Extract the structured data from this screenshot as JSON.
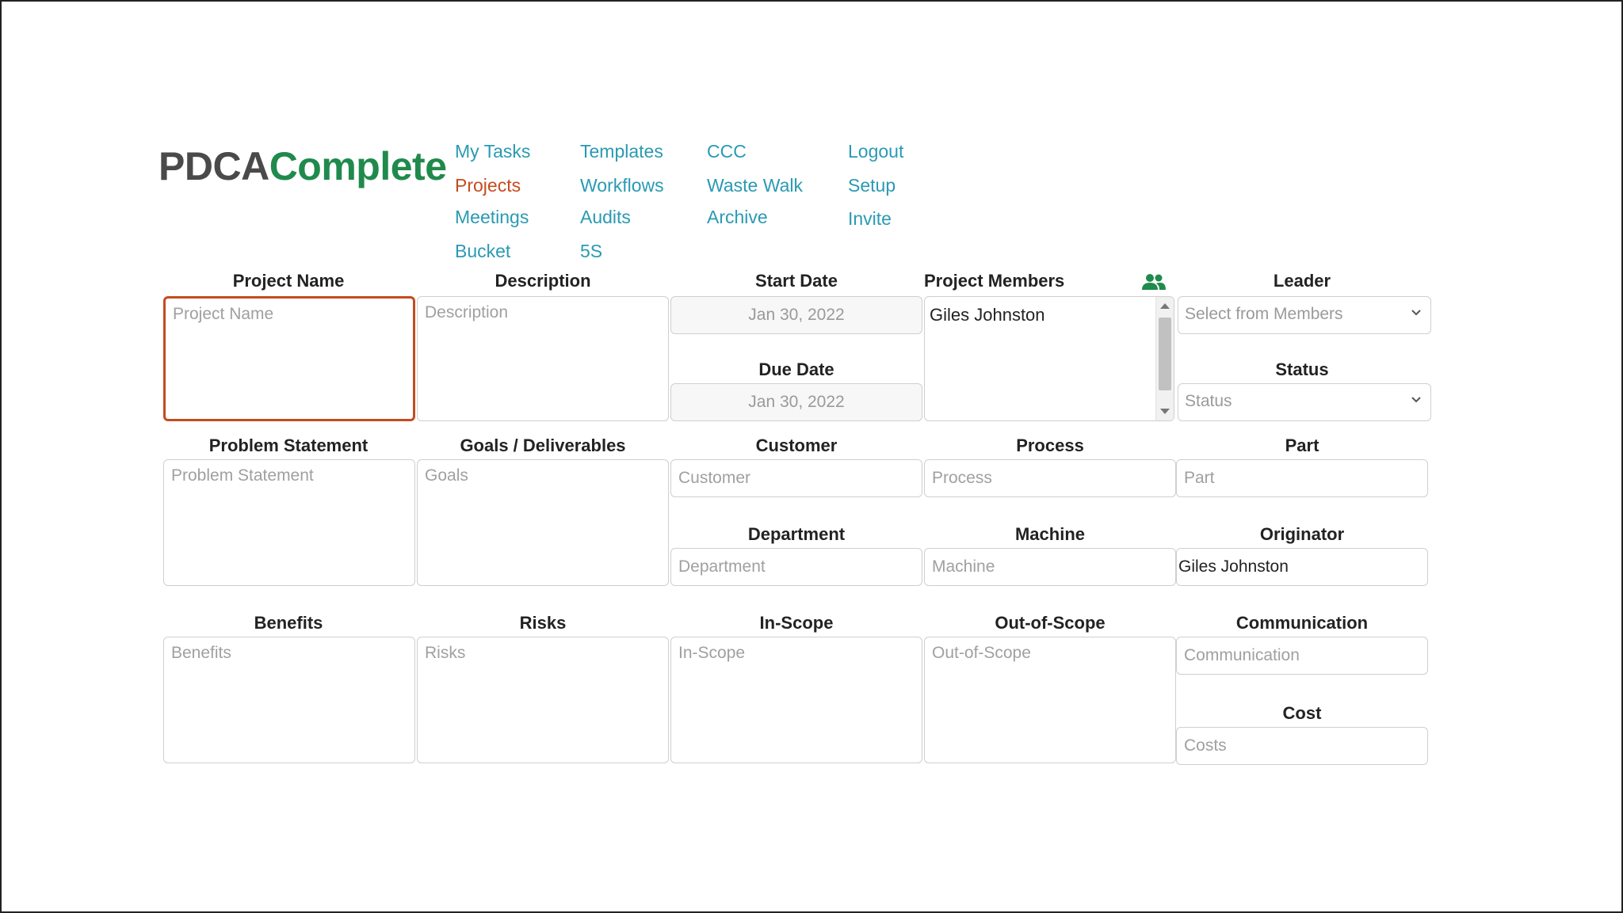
{
  "logo": {
    "part1": "PDCA",
    "part2": "Complete"
  },
  "nav": {
    "my_tasks": "My Tasks",
    "projects": "Projects",
    "meetings": "Meetings",
    "bucket": "Bucket",
    "templates": "Templates",
    "workflows": "Workflows",
    "audits": "Audits",
    "five_s": "5S",
    "ccc": "CCC",
    "waste_walk": "Waste Walk",
    "archive": "Archive",
    "logout": "Logout",
    "setup": "Setup",
    "invite": "Invite",
    "active": "projects"
  },
  "form": {
    "project_name": {
      "label": "Project Name",
      "placeholder": "Project Name"
    },
    "description": {
      "label": "Description",
      "placeholder": "Description"
    },
    "start_date": {
      "label": "Start Date",
      "value": "Jan 30, 2022"
    },
    "due_date": {
      "label": "Due Date",
      "value": "Jan 30, 2022"
    },
    "project_members": {
      "label": "Project Members",
      "members": [
        "Giles Johnston"
      ],
      "icon": "people-icon"
    },
    "leader": {
      "label": "Leader",
      "value": "Select from Members"
    },
    "status": {
      "label": "Status",
      "value": "Status"
    },
    "problem_statement": {
      "label": "Problem Statement",
      "placeholder": "Problem Statement"
    },
    "goals": {
      "label": "Goals / Deliverables",
      "placeholder": "Goals"
    },
    "customer": {
      "label": "Customer",
      "placeholder": "Customer"
    },
    "process": {
      "label": "Process",
      "placeholder": "Process"
    },
    "part": {
      "label": "Part",
      "placeholder": "Part"
    },
    "department": {
      "label": "Department",
      "placeholder": "Department"
    },
    "machine": {
      "label": "Machine",
      "placeholder": "Machine"
    },
    "originator": {
      "label": "Originator",
      "value": "Giles Johnston"
    },
    "benefits": {
      "label": "Benefits",
      "placeholder": "Benefits"
    },
    "risks": {
      "label": "Risks",
      "placeholder": "Risks"
    },
    "in_scope": {
      "label": "In-Scope",
      "placeholder": "In-Scope"
    },
    "out_of_scope": {
      "label": "Out-of-Scope",
      "placeholder": "Out-of-Scope"
    },
    "communication": {
      "label": "Communication",
      "placeholder": "Communication"
    },
    "cost": {
      "label": "Cost",
      "placeholder": "Costs"
    }
  },
  "colors": {
    "link": "#2a9ab3",
    "active_link": "#c64b1f",
    "logo_dark": "#4a4a4a",
    "logo_green": "#1f8a4c",
    "focus_border": "#c64b1f",
    "members_icon": "#1f8a4c"
  }
}
